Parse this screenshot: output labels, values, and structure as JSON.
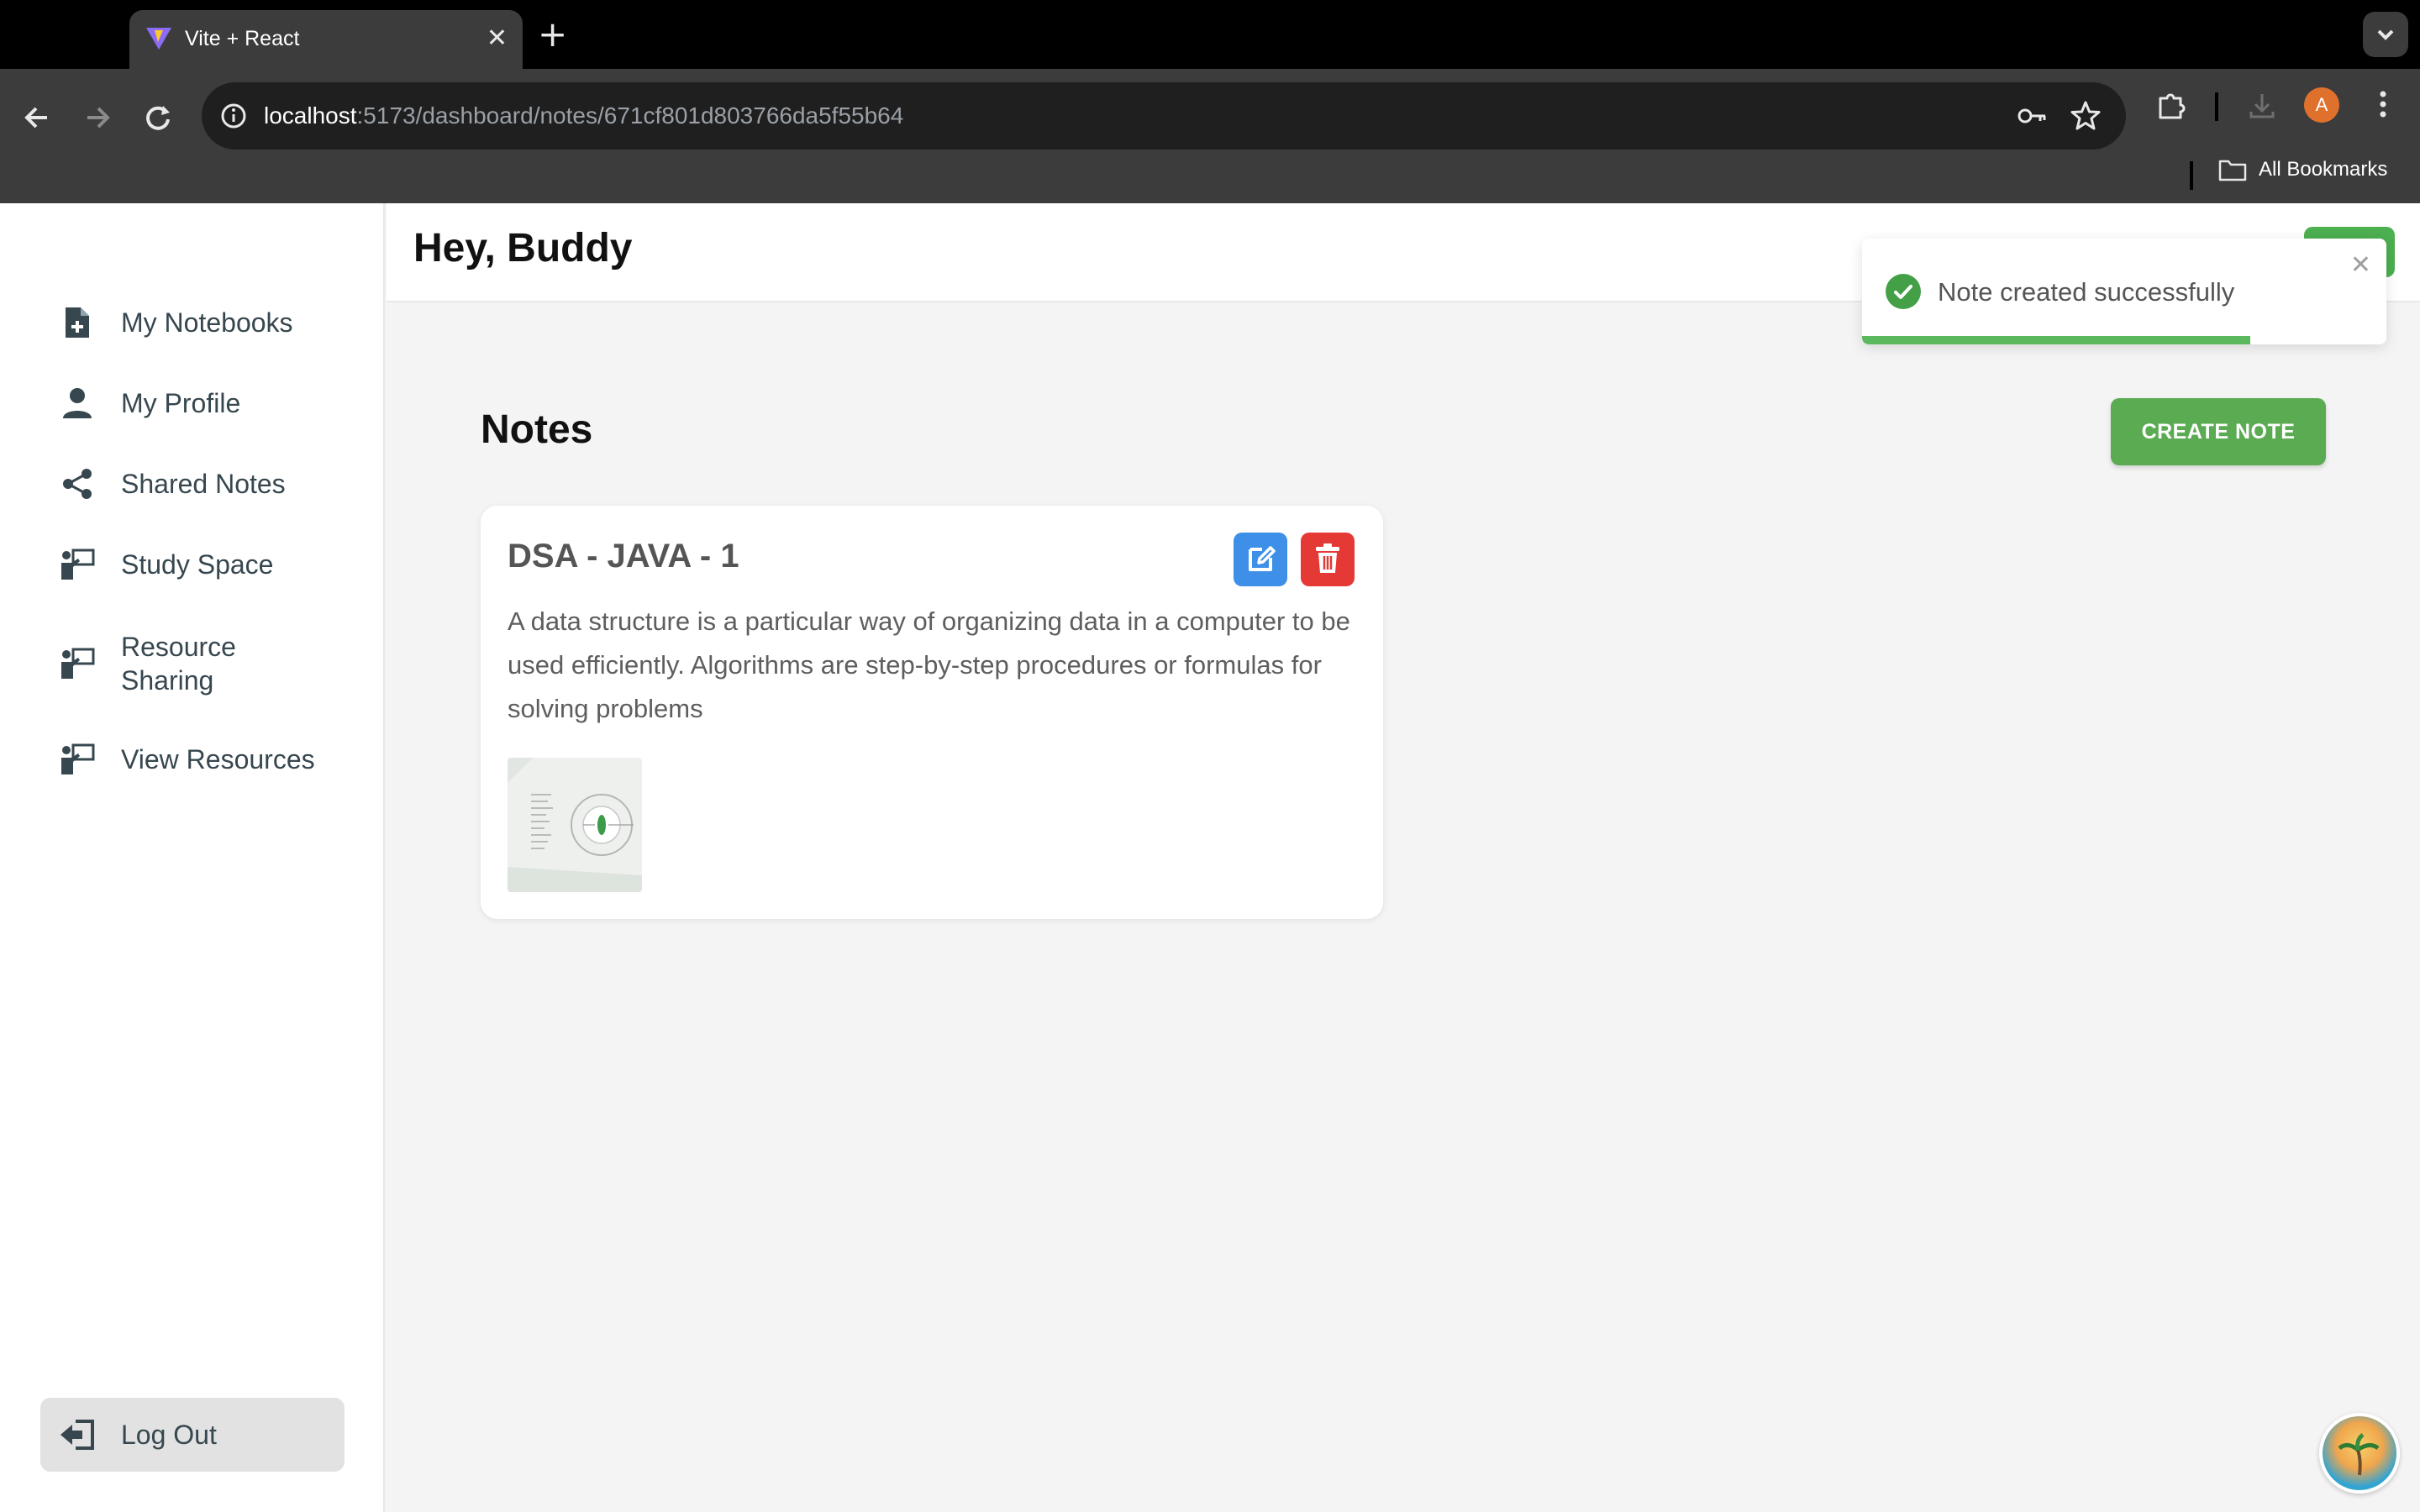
{
  "browser": {
    "tab_title": "Vite + React",
    "url_host": "localhost",
    "url_path": ":5173/dashboard/notes/671cf801d803766da5f55b64",
    "profile_initial": "A",
    "bookmarks_label": "All Bookmarks"
  },
  "sidebar": {
    "items": [
      {
        "label": "My Notebooks",
        "icon": "file-plus-icon"
      },
      {
        "label": "My Profile",
        "icon": "user-icon"
      },
      {
        "label": "Shared Notes",
        "icon": "share-icon"
      },
      {
        "label": "Study Space",
        "icon": "teacher-board-icon"
      },
      {
        "label": "Resource",
        "label2": "Sharing",
        "icon": "teacher-board-icon"
      },
      {
        "label": "View Resources",
        "icon": "teacher-board-icon"
      }
    ],
    "logout_label": "Log Out"
  },
  "header": {
    "greeting": "Hey, Buddy"
  },
  "toast": {
    "message": "Note created successfully",
    "progress": 0.74,
    "status_color": "#43a047"
  },
  "main": {
    "section_title": "Notes",
    "create_label": "CREATE NOTE",
    "notes": [
      {
        "title": "DSA - JAVA - 1",
        "body": "A data structure is a particular way of organizing data in a computer to be used efficiently. Algorithms are step-by-step procedures or formulas for solving problems"
      }
    ]
  },
  "colors": {
    "accent_green": "#5aab52",
    "edit_blue": "#3d8fe8",
    "delete_red": "#e53935"
  }
}
